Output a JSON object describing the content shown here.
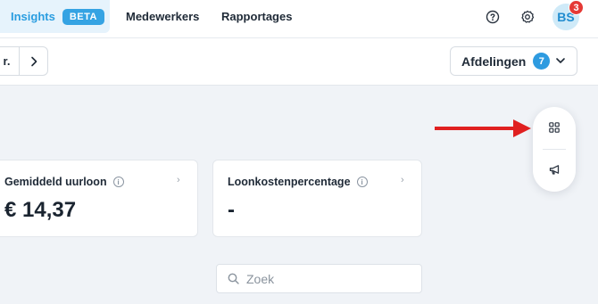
{
  "nav": {
    "tabs": [
      {
        "label": "Insights",
        "badge": "BETA",
        "active": true
      },
      {
        "label": "Medewerkers"
      },
      {
        "label": "Rapportages"
      }
    ],
    "help_icon": "help-circle-icon",
    "settings_icon": "gear-icon",
    "avatar_initials": "BS",
    "notification_count": "3"
  },
  "filters": {
    "period_label_partial": "r.",
    "next_icon": "chevron-right-icon",
    "departments_label": "Afdelingen",
    "departments_count": "7"
  },
  "cards": [
    {
      "label": "Gemiddeld uurloon",
      "value": "€ 14,37"
    },
    {
      "label": "Loonkostenpercentage",
      "value": "-"
    }
  ],
  "side_panel": {
    "top_icon": "dashboard-grid-icon",
    "bottom_icon": "megaphone-icon"
  },
  "search": {
    "placeholder": "Zoek",
    "value": ""
  },
  "colors": {
    "accent": "#2a9de0",
    "badge": "#35a3e3",
    "notification": "#e53935",
    "annotation_arrow": "#e02020"
  }
}
